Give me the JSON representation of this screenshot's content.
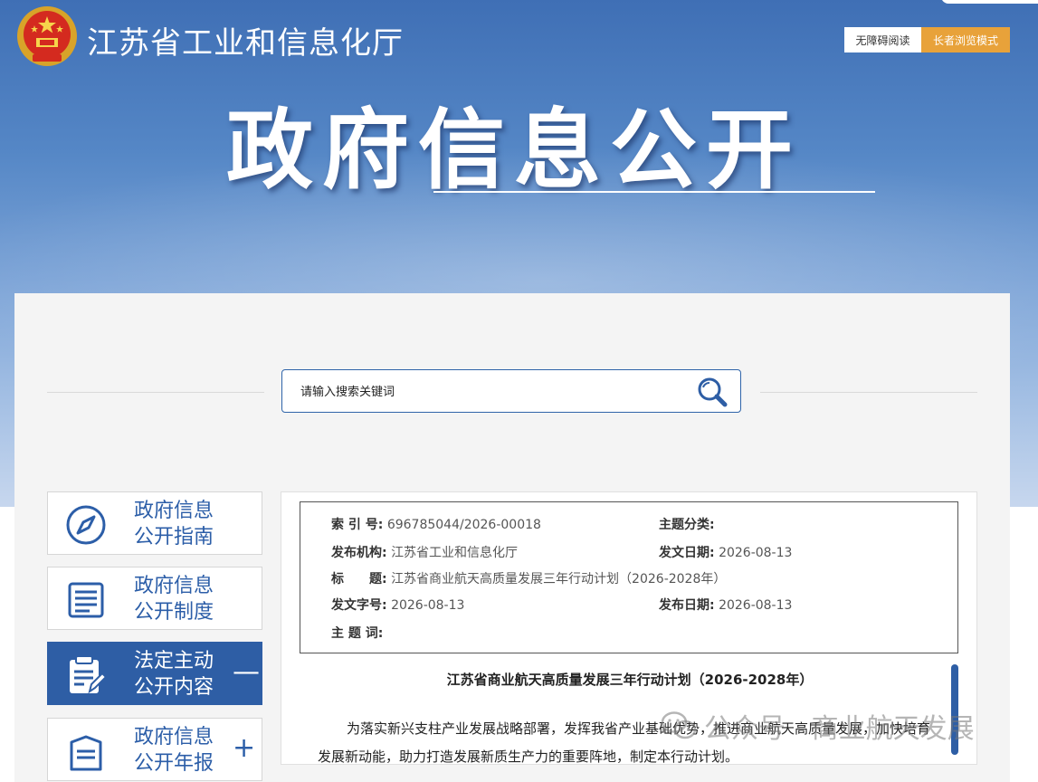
{
  "header": {
    "site_name": "江苏省工业和信息化厅",
    "accessibility_label": "无障碍阅读",
    "elder_mode_label": "长者浏览模式",
    "hero_title": "政府信息公开"
  },
  "search": {
    "placeholder": "请输入搜索关键词"
  },
  "sidebar": {
    "items": [
      {
        "label": "政府信息\n公开指南",
        "icon": "compass-icon"
      },
      {
        "label": "政府信息\n公开制度",
        "icon": "document-list-icon"
      },
      {
        "label": "法定主动\n公开内容",
        "icon": "clipboard-edit-icon",
        "toggle": "—"
      },
      {
        "label": "政府信息\n公开年报",
        "icon": "report-icon",
        "toggle": "+"
      }
    ]
  },
  "meta": {
    "index_key": "索 引 号:",
    "index_val": "696785044/2026-00018",
    "category_key": "主题分类:",
    "category_val": "",
    "publisher_key": "发布机构:",
    "publisher_val": "江苏省工业和信息化厅",
    "issue_date_key": "发文日期:",
    "issue_date_val": "2026-08-13",
    "title_key": "标　　题:",
    "title_val": "江苏省商业航天高质量发展三年行动计划（2026-2028年）",
    "doc_no_key": "发文字号:",
    "doc_no_val": "2026-08-13",
    "publish_date_key": "发布日期:",
    "publish_date_val": "2026-08-13",
    "keywords_key": "主 题 词:",
    "keywords_val": ""
  },
  "document": {
    "title": "江苏省商业航天高质量发展三年行动计划（2026-2028年）",
    "paragraph": "为落实新兴支柱产业发展战略部署，发挥我省产业基础优势，推进商业航天高质量发展，加快培育发展新动能，助力打造发展新质生产力的重要阵地，制定本行动计划。"
  },
  "watermark": {
    "text": "公众号 · 商业航天发展"
  },
  "colors": {
    "primary": "#2e5ea5",
    "accent": "#e8a23a"
  }
}
